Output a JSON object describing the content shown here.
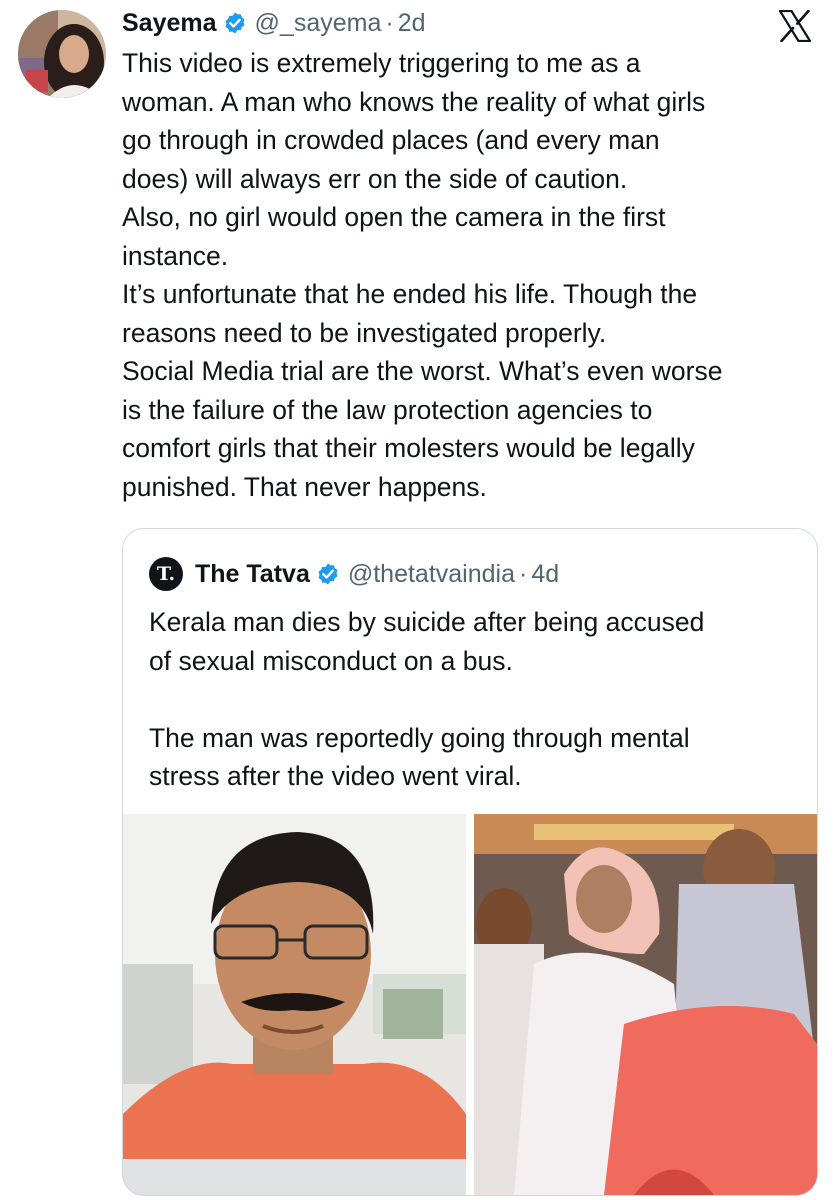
{
  "tweet": {
    "author": {
      "name": "Sayema",
      "handle": "@_sayema",
      "time": "2d"
    },
    "separator": "·",
    "lines": [
      "This video is extremely triggering to me as a",
      "woman. A man who knows the reality of what girls",
      "go through in crowded places (and every man",
      "does) will always err on the side of caution.",
      "Also, no girl would open the camera in the first",
      "instance.",
      "It’s unfortunate that he ended his life. Though the",
      "reasons need to be investigated properly.",
      "Social Media trial are the worst. What’s even worse",
      "is the failure of the law protection agencies to",
      "comfort girls that their molesters would be legally",
      "punished. That never happens."
    ]
  },
  "quoted": {
    "avatar_letter": "T.",
    "name": "The Tatva",
    "handle": "@thetatvaindia",
    "time": "4d",
    "separator": "·",
    "lines": [
      "Kerala man dies by suicide after being accused",
      "of sexual misconduct on a bus.",
      "",
      "The man was reportedly going through mental",
      "stress after the video went viral."
    ]
  },
  "icons": {
    "verified": "verified-badge-icon",
    "platform": "x-logo-icon"
  },
  "colors": {
    "text": "#0f1419",
    "secondary": "#536471",
    "verified": "#1d9bf0",
    "border": "#cfd9de"
  }
}
